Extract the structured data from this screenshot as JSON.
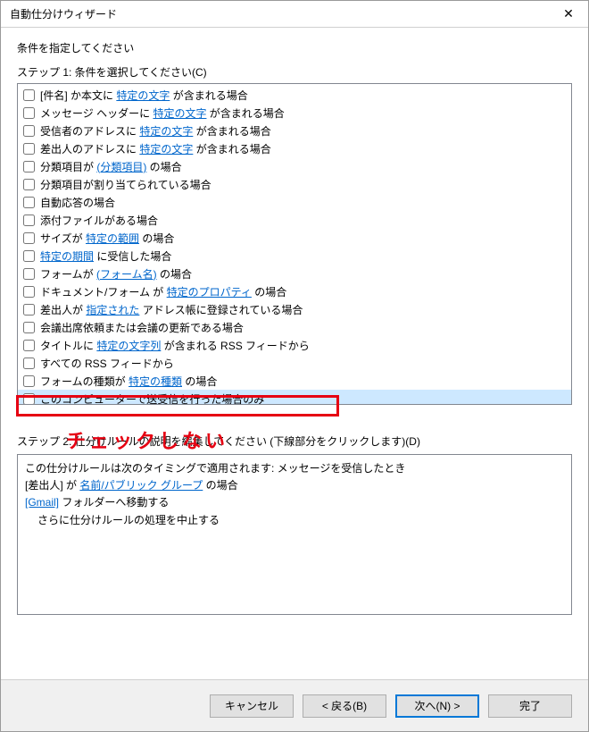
{
  "title": "自動仕分けウィザード",
  "heading": "条件を指定してください",
  "step1_label": "ステップ 1: 条件を選択してください(C)",
  "items": [
    {
      "pre": "[件名] か本文に ",
      "link": "特定の文字",
      "post": " が含まれる場合"
    },
    {
      "pre": "メッセージ ヘッダーに ",
      "link": "特定の文字",
      "post": " が含まれる場合"
    },
    {
      "pre": "受信者のアドレスに ",
      "link": "特定の文字",
      "post": " が含まれる場合"
    },
    {
      "pre": "差出人のアドレスに ",
      "link": "特定の文字",
      "post": " が含まれる場合"
    },
    {
      "pre": "分類項目が ",
      "link": "(分類項目)",
      "post": " の場合"
    },
    {
      "pre": "分類項目が割り当てられている場合",
      "link": "",
      "post": ""
    },
    {
      "pre": "自動応答の場合",
      "link": "",
      "post": ""
    },
    {
      "pre": "添付ファイルがある場合",
      "link": "",
      "post": ""
    },
    {
      "pre": "サイズが ",
      "link": "特定の範囲",
      "post": " の場合"
    },
    {
      "pre": "",
      "link": "特定の期間",
      "post": " に受信した場合"
    },
    {
      "pre": "フォームが ",
      "link": "(フォーム名)",
      "post": " の場合"
    },
    {
      "pre": "ドキュメント/フォーム が ",
      "link": "特定のプロパティ",
      "post": " の場合"
    },
    {
      "pre": "差出人が ",
      "link": "指定された",
      "post": " アドレス帳に登録されている場合"
    },
    {
      "pre": "会議出席依頼または会議の更新である場合",
      "link": "",
      "post": ""
    },
    {
      "pre": "タイトルに ",
      "link": "特定の文字列",
      "post": " が含まれる RSS フィードから"
    },
    {
      "pre": "すべての RSS フィードから",
      "link": "",
      "post": ""
    },
    {
      "pre": "フォームの種類が ",
      "link": "特定の種類",
      "post": " の場合"
    },
    {
      "pre": "このコンピューターで送受信を行った場合のみ",
      "link": "",
      "post": "",
      "selected": true
    }
  ],
  "annotation": "チェックしない",
  "step2_label": "ステップ 2: 仕分けルールの説明を編集してください (下線部分をクリックします)(D)",
  "desc": {
    "line1": "この仕分けルールは次のタイミングで適用されます: メッセージを受信したとき",
    "line2_pre": "[差出人] が ",
    "line2_link": "名前/パブリック グループ",
    "line2_post": " の場合",
    "line3_link": "[Gmail]",
    "line3_post": " フォルダーへ移動する",
    "line4": "さらに仕分けルールの処理を中止する"
  },
  "buttons": {
    "cancel": "キャンセル",
    "back": "< 戻る(B)",
    "next": "次へ(N) >",
    "finish": "完了"
  }
}
